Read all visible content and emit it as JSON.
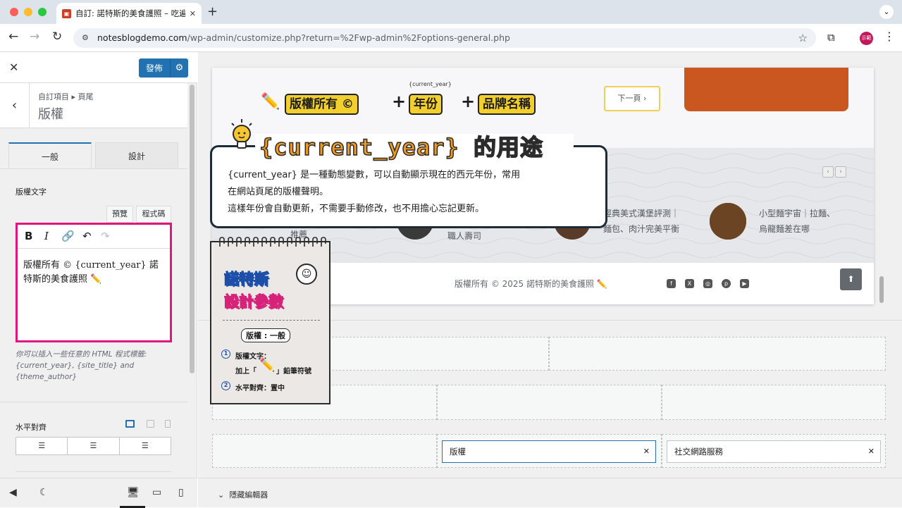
{
  "browser": {
    "tab_title": "自訂: 諾特斯的美食護照 – 吃遍",
    "url_host": "notesblogdemo.com",
    "url_path": "/wp-admin/customize.php?return=%2Fwp-admin%2Foptions-general.php",
    "avatar_text": "示範"
  },
  "sidebar": {
    "publish_label": "發佈",
    "breadcrumb": "自訂項目 ▸ 頁尾",
    "section_title": "版權",
    "tabs": [
      "一般",
      "設計"
    ],
    "copyright_label": "版權文字",
    "editor_modes": [
      "預覽",
      "程式碼"
    ],
    "editor_content": "版權所有 © {current_year} 諾特斯的美食護照 ✏️",
    "help_text": "你可以插入一些任意的 HTML 程式標籤: {current_year}, {site_title} and {theme_author}",
    "align_label": "水平對齊"
  },
  "preview": {
    "next_button": "下一頁 ›",
    "posts": [
      {
        "lines": [
          "推薦"
        ]
      },
      {
        "lines": [
          "職人壽司"
        ]
      },
      {
        "lines": [
          "經典美式漢堡評測｜",
          "麵包、肉汁完美平衡"
        ]
      },
      {
        "lines": [
          "小型麵宇宙｜拉麵、",
          "烏龍麵差在哪"
        ]
      }
    ],
    "copyright_line": "版權所有 © 2025 諾特斯的美食護照 ✏️",
    "social_icons": [
      "facebook-icon",
      "x-icon",
      "instagram-icon",
      "pinterest-icon",
      "youtube-icon"
    ],
    "chip_copyright": "版權",
    "chip_social": "社交網路服務",
    "hide_editor": "隱藏編輯器"
  },
  "annotation": {
    "formula": {
      "b1": "版權所有 ©",
      "b2": "年份",
      "b3": "品牌名稱",
      "small": "{current_year}"
    },
    "bubble_title": "{current_year}",
    "bubble_title_suffix": "的用途",
    "bubble_lines": [
      "{current_year} 是一種動態變數，可以自動顯示現在的西元年份，常用",
      "在網站頁尾的版權聲明。",
      "這樣年份會自動更新，不需要手動修改，也不用擔心忘記更新。"
    ],
    "note": {
      "h1": "諾特斯",
      "h2": "設計參數",
      "tag": "版權 : 一般",
      "item1_title": "版權文字：",
      "item1_a": "加上「",
      "item1_b": "」鉛筆符號",
      "item2": "水平對齊：置中"
    }
  },
  "colors": {
    "accent": "#2271b1",
    "highlight_border": "#e0157d",
    "badge_yellow": "#f2cf2c",
    "title_orange": "#f29a1e"
  }
}
